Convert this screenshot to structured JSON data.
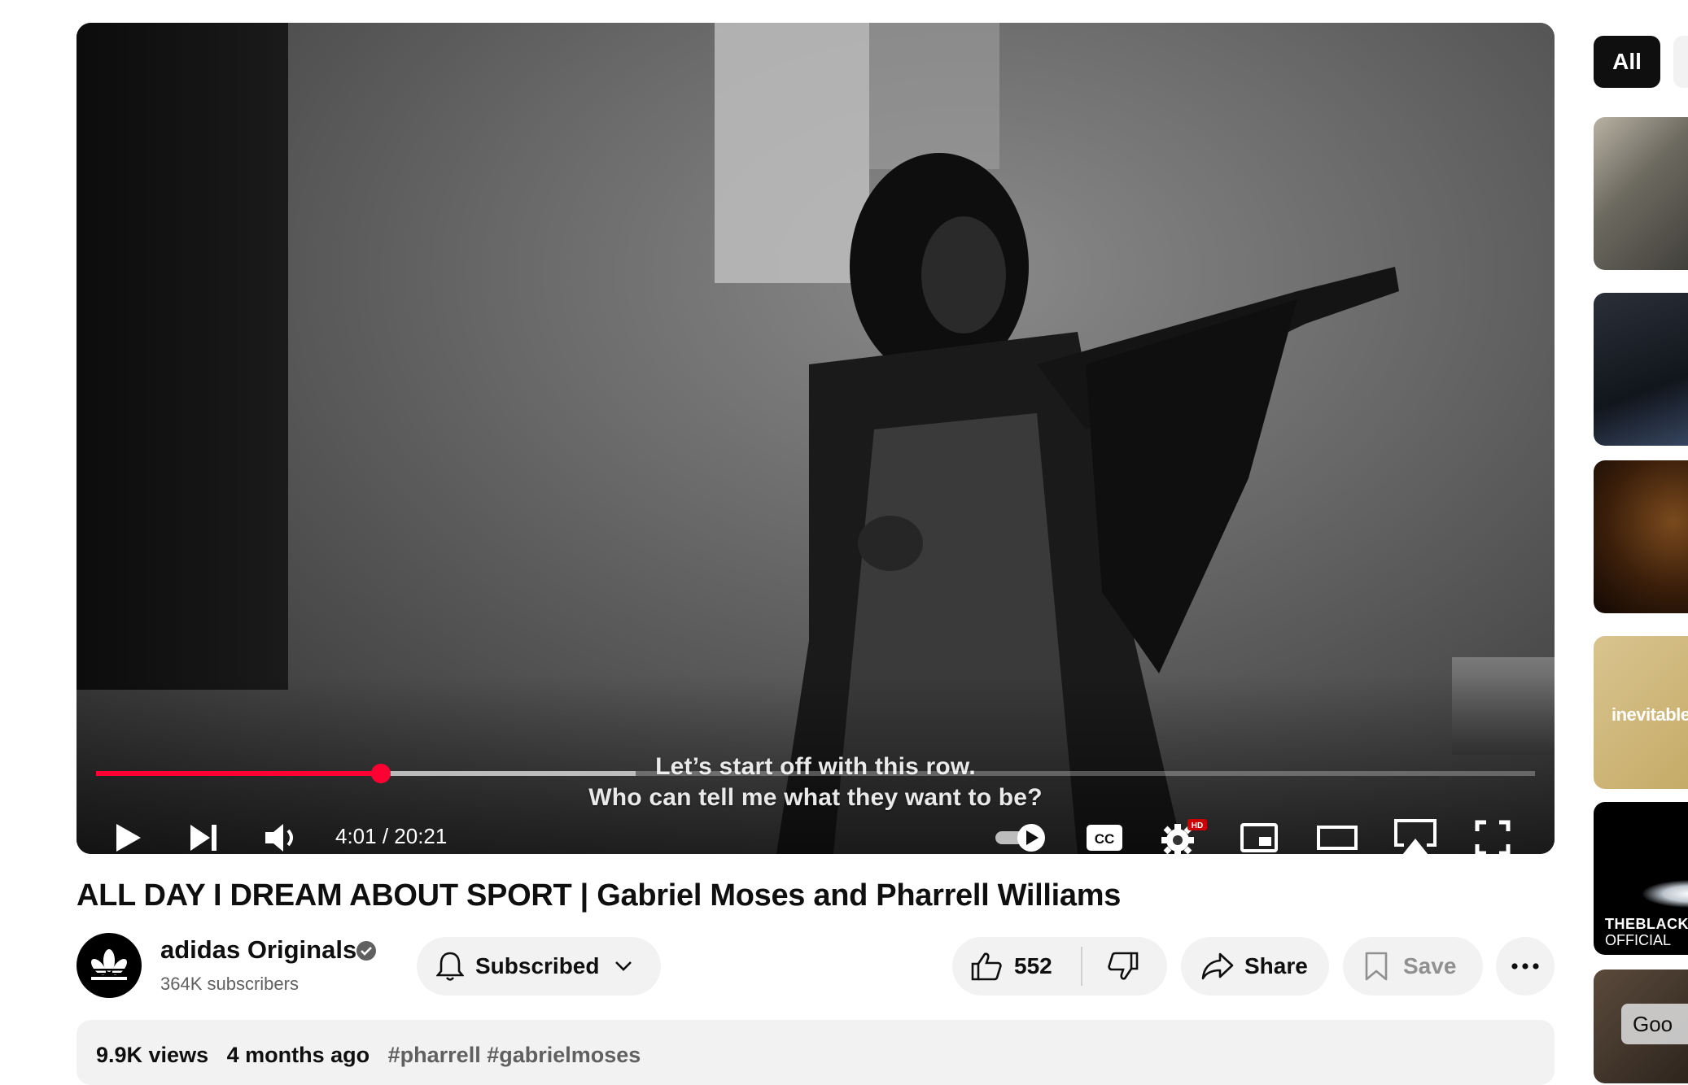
{
  "player": {
    "subtitle_line1": "Let’s start off with this row.",
    "subtitle_line2": "Who can tell me what they want to be?",
    "current_time": "4:01",
    "duration": "20:21",
    "time_display": "4:01 / 20:21",
    "progress_fraction": 0.198,
    "buffered_fraction": 0.177,
    "settings_badge": "HD",
    "accent_color": "#ff0033"
  },
  "video": {
    "title": "ALL DAY I DREAM ABOUT SPORT | Gabriel Moses and Pharrell Williams"
  },
  "channel": {
    "name": "adidas Originals",
    "subscribers": "364K subscribers",
    "verified": true
  },
  "actions": {
    "subscribe_label": "Subscribed",
    "like_count": "552",
    "share_label": "Share",
    "save_label": "Save"
  },
  "description": {
    "views": "9.9K views",
    "age": "4 months ago",
    "hashtags": "#pharrell #gabrielmoses"
  },
  "sidebar": {
    "chip_all": "All",
    "thumb4_text": "inevitable.",
    "thumb5_text1": "THEBLACKLA",
    "thumb5_text2": "OFFICIAL",
    "thumb6_chip": "Goo"
  }
}
